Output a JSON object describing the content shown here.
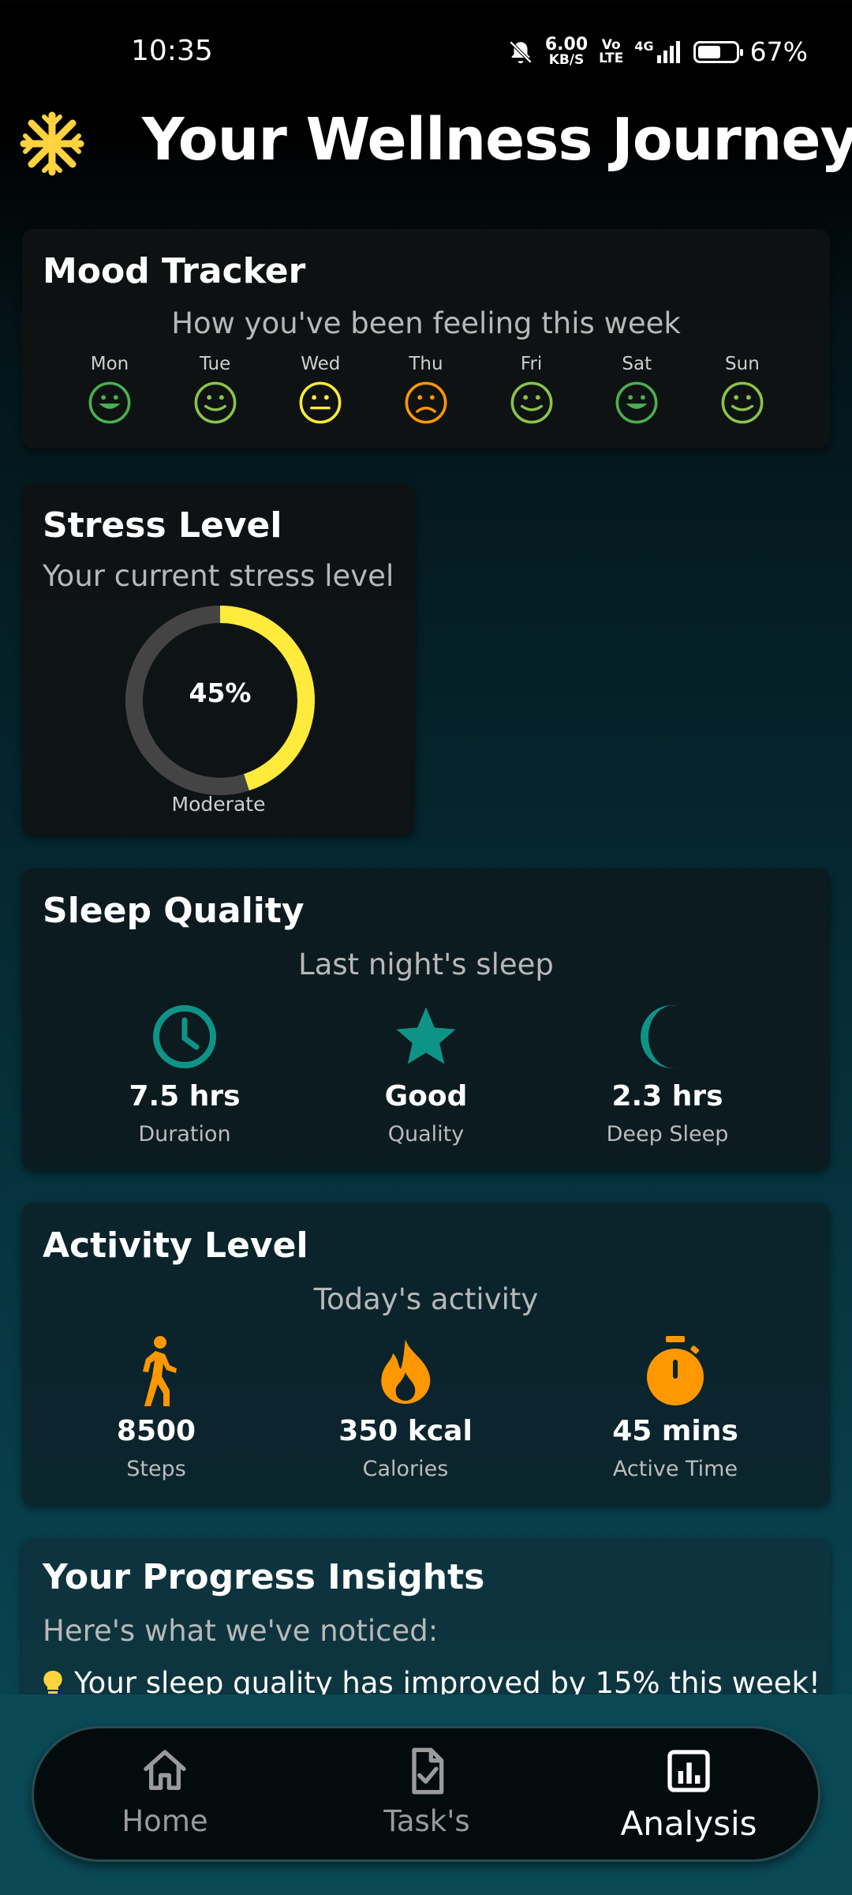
{
  "status_bar": {
    "time": "10:35",
    "net_speed": "6.00",
    "net_unit": "KB/S",
    "volte_top": "Vo",
    "volte_bottom": "LTE",
    "network": "4G",
    "battery": "67%",
    "battery_level": 0.67
  },
  "header": {
    "title": "Your Wellness Journey",
    "logo_icon": "snowflake-icon"
  },
  "mood": {
    "title": "Mood Tracker",
    "subtitle": "How you've been feeling this week",
    "days": [
      {
        "day": "Mon",
        "mood": "very-happy",
        "color": "#4caf50"
      },
      {
        "day": "Tue",
        "mood": "happy",
        "color": "#8bc34a"
      },
      {
        "day": "Wed",
        "mood": "neutral",
        "color": "#ffeb3b"
      },
      {
        "day": "Thu",
        "mood": "sad",
        "color": "#ff9800"
      },
      {
        "day": "Fri",
        "mood": "happy",
        "color": "#8bc34a"
      },
      {
        "day": "Sat",
        "mood": "very-happy",
        "color": "#4caf50"
      },
      {
        "day": "Sun",
        "mood": "happy",
        "color": "#8bc34a"
      }
    ]
  },
  "stress": {
    "title": "Stress Level",
    "subtitle": "Your current stress level",
    "value_text": "45%",
    "value": 0.45,
    "label": "Moderate",
    "color": "#ffeb3b",
    "track_color": "#444444"
  },
  "sleep": {
    "title": "Sleep Quality",
    "subtitle": "Last night's sleep",
    "color": "#0e9487",
    "stats": [
      {
        "icon": "clock-icon",
        "value": "7.5 hrs",
        "label": "Duration"
      },
      {
        "icon": "star-icon",
        "value": "Good",
        "label": "Quality"
      },
      {
        "icon": "moon-icon",
        "value": "2.3 hrs",
        "label": "Deep Sleep"
      }
    ]
  },
  "activity": {
    "title": "Activity Level",
    "subtitle": "Today's activity",
    "color": "#ff9800",
    "stats": [
      {
        "icon": "walking-icon",
        "value": "8500",
        "label": "Steps"
      },
      {
        "icon": "fire-icon",
        "value": "350 kcal",
        "label": "Calories"
      },
      {
        "icon": "stopwatch-icon",
        "value": "45 mins",
        "label": "Active Time"
      }
    ]
  },
  "insights": {
    "title": "Your Progress Insights",
    "subtitle": "Here's what we've noticed:",
    "items": [
      {
        "icon": "lightbulb-icon",
        "text": "Your sleep quality has improved by 15% this week!"
      }
    ]
  },
  "nav": {
    "items": [
      {
        "icon": "home-icon",
        "label": "Home",
        "active": false
      },
      {
        "icon": "task-icon",
        "label": "Task's",
        "active": false
      },
      {
        "icon": "analysis-icon",
        "label": "Analysis",
        "active": true
      }
    ]
  }
}
